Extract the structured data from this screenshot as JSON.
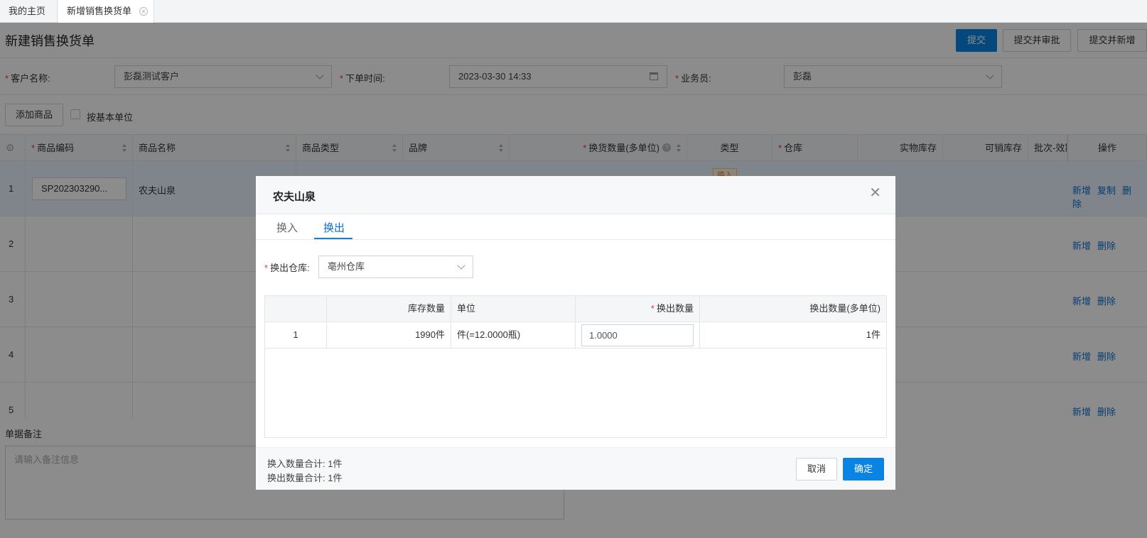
{
  "tabs": {
    "home": "我的主页",
    "active": "新增销售换货单"
  },
  "page": {
    "title": "新建销售换货单",
    "submit": "提交",
    "submit_approve": "提交并审批",
    "submit_new": "提交并新增"
  },
  "form": {
    "customer_label": "客户名称:",
    "customer_value": "彭磊测试客户",
    "order_time_label": "下单时间:",
    "order_time_value": "2023-03-30 14:33",
    "salesman_label": "业务员:",
    "salesman_value": "彭磊"
  },
  "toolbar": {
    "add_product": "添加商品",
    "base_unit": "按基本单位"
  },
  "grid": {
    "columns": [
      "商品编码",
      "商品名称",
      "商品类型",
      "品牌",
      "换货数量(多单位)",
      "类型",
      "仓库",
      "实物库存",
      "可销库存",
      "批次-效期",
      "操作"
    ],
    "rows": [
      {
        "num": "1",
        "code": "SP202303290...",
        "name": "农夫山泉",
        "type_badge": "换入",
        "ops": [
          "新增",
          "复制",
          "删除"
        ]
      },
      {
        "num": "2",
        "ops": [
          "新增",
          "删除"
        ]
      },
      {
        "num": "3",
        "ops": [
          "新增",
          "删除"
        ]
      },
      {
        "num": "4",
        "ops": [
          "新增",
          "删除"
        ]
      },
      {
        "num": "5",
        "ops": [
          "新增",
          "删除"
        ]
      }
    ]
  },
  "remark": {
    "label": "单据备注",
    "placeholder": "请输入备注信息"
  },
  "modal": {
    "title": "农夫山泉",
    "tabs": [
      "换入",
      "换出"
    ],
    "active_tab": "换出",
    "warehouse_label": "换出仓库:",
    "warehouse_value": "亳州仓库",
    "table": {
      "headers": [
        "",
        "库存数量",
        "单位",
        "换出数量",
        "换出数量(多单位)"
      ],
      "row": {
        "num": "1",
        "stock": "1990件",
        "unit": "件(=12.0000瓶)",
        "qty": "1.0000",
        "qty_multi": "1件"
      }
    },
    "sum_in": "换入数量合计: 1件",
    "sum_out": "换出数量合计: 1件",
    "cancel": "取消",
    "ok": "确定"
  },
  "colors": {
    "primary": "#0a84e3",
    "link": "#0a6fd0",
    "required": "#e53935"
  }
}
